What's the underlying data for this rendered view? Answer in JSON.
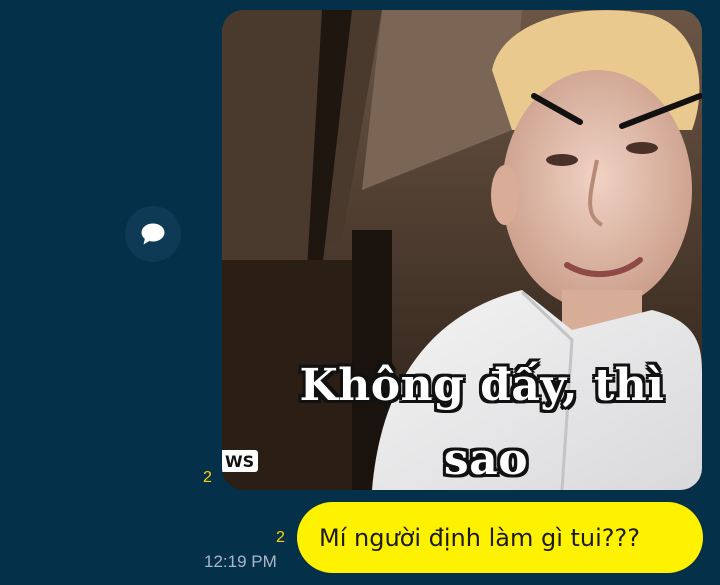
{
  "chat": {
    "reply_icon": "speech-bubble-icon",
    "media_message": {
      "caption_line1": "Không đấy, thì",
      "caption_line2": "sao",
      "watermark": "WS",
      "read_count": "2"
    },
    "text_message": {
      "text": "Mí người định làm gì tui???",
      "read_count": "2",
      "time": "12:19 PM"
    }
  },
  "colors": {
    "background": "#05304a",
    "bubble": "#fff200",
    "read_count": "#ffd400",
    "timestamp": "#a8b8c6"
  }
}
